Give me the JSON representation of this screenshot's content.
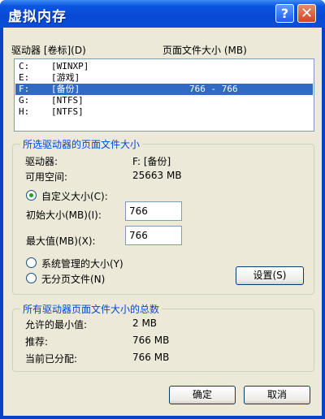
{
  "window": {
    "title": "虚拟内存",
    "help_glyph": "?",
    "close_glyph": "✕"
  },
  "drives": {
    "header_drive": "驱动器 [卷标](D)",
    "header_size": "页面文件大小 (MB)",
    "rows": [
      {
        "drive": "C:",
        "label": "[WINXP]",
        "size": "",
        "selected": false
      },
      {
        "drive": "E:",
        "label": "[游戏]",
        "size": "",
        "selected": false
      },
      {
        "drive": "F:",
        "label": "[备份]",
        "size": "766 - 766",
        "selected": true
      },
      {
        "drive": "G:",
        "label": "[NTFS]",
        "size": "",
        "selected": false
      },
      {
        "drive": "H:",
        "label": "[NTFS]",
        "size": "",
        "selected": false
      }
    ]
  },
  "selected_drive": {
    "group_title": "所选驱动器的页面文件大小",
    "drive_label": "驱动器:",
    "drive_value": "F:  [备份]",
    "space_label": "可用空间:",
    "space_value": "25663 MB",
    "custom_label": "自定义大小(C):",
    "initial_label": "初始大小(MB)(I):",
    "initial_value": "766",
    "max_label": "最大值(MB)(X):",
    "max_value": "766",
    "system_label": "系统管理的大小(Y)",
    "none_label": "无分页文件(N)",
    "set_button": "设置(S)",
    "mode": "custom"
  },
  "totals": {
    "group_title": "所有驱动器页面文件大小的总数",
    "min_label": "允许的最小值:",
    "min_value": "2 MB",
    "rec_label": "推荐:",
    "rec_value": "766 MB",
    "alloc_label": "当前已分配:",
    "alloc_value": "766 MB"
  },
  "buttons": {
    "ok": "确定",
    "cancel": "取消"
  },
  "colors": {
    "titlebar": "#0a55e0",
    "selection": "#316ac5",
    "group_title": "#0046d5",
    "face": "#ece9d8"
  }
}
